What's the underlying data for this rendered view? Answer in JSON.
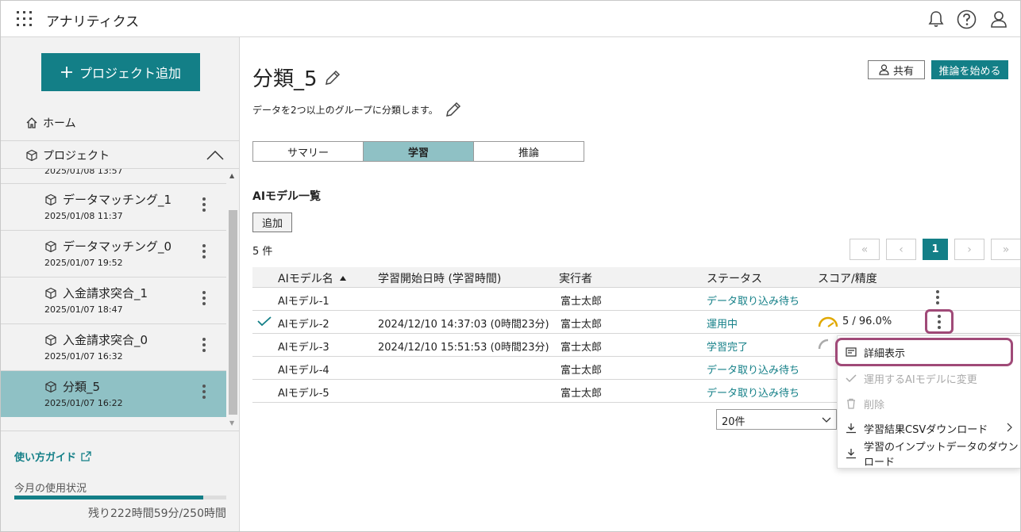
{
  "header": {
    "app_title": "アナリティクス",
    "icons": [
      "apps-icon",
      "bell-icon",
      "help-icon",
      "user-icon"
    ]
  },
  "sidebar": {
    "add_project_label": "プロジェクト追加",
    "home_label": "ホーム",
    "project_label": "プロジェクト",
    "clipped_date": "2025/01/08 13:57",
    "projects": [
      {
        "name": "データマッチング_1",
        "date": "2025/01/08 11:37"
      },
      {
        "name": "データマッチング_0",
        "date": "2025/01/07 19:52"
      },
      {
        "name": "入金請求突合_1",
        "date": "2025/01/07 18:47"
      },
      {
        "name": "入金請求突合_0",
        "date": "2025/01/07 16:32"
      },
      {
        "name": "分類_5",
        "date": "2025/01/07 16:22",
        "active": true
      }
    ],
    "guide_label": "使い方ガイド",
    "usage_title": "今月の使用状況",
    "usage_text": "残り222時間59分/250時間",
    "usage_fraction": 0.89
  },
  "main": {
    "title": "分類_5",
    "description": "データを2つ以上のグループに分類します。",
    "share_label": "共有",
    "infer_label": "推論を始める",
    "tabs": [
      "サマリー",
      "学習",
      "推論"
    ],
    "active_tab": 1,
    "section_title": "AIモデル一覧",
    "add_label": "追加",
    "count": "5 件",
    "pager": {
      "first": "«",
      "prev": "‹",
      "current": "1",
      "next": "›",
      "last": "»"
    },
    "table": {
      "columns": [
        "AIモデル名",
        "学習開始日時 (学習時間)",
        "実行者",
        "ステータス",
        "スコア/精度"
      ],
      "rows": [
        {
          "name": "AIモデル-1",
          "start": "",
          "user": "富士太郎",
          "status": "データ取り込み待ち",
          "score": "",
          "checked": false
        },
        {
          "name": "AIモデル-2",
          "start": "2024/12/10 14:37:03 (0時間23分)",
          "user": "富士太郎",
          "status": "運用中",
          "score": "5 / 96.0%",
          "checked": true
        },
        {
          "name": "AIモデル-3",
          "start": "2024/12/10 15:51:53 (0時間23分)",
          "user": "富士太郎",
          "status": "学習完了",
          "score": "",
          "checked": false
        },
        {
          "name": "AIモデル-4",
          "start": "",
          "user": "富士太郎",
          "status": "データ取り込み待ち",
          "score": "",
          "checked": false
        },
        {
          "name": "AIモデル-5",
          "start": "",
          "user": "富士太郎",
          "status": "データ取り込み待ち",
          "score": "",
          "checked": false
        }
      ]
    },
    "per_page": "20件"
  },
  "context_menu": {
    "items": [
      {
        "label": "詳細表示",
        "icon": "detail-icon",
        "disabled": false
      },
      {
        "label": "運用するAIモデルに変更",
        "icon": "check-icon",
        "disabled": true
      },
      {
        "label": "削除",
        "icon": "trash-icon",
        "disabled": true
      },
      {
        "label": "学習結果CSVダウンロード",
        "icon": "download-icon",
        "disabled": false,
        "submenu": true
      },
      {
        "label": "学習のインプットデータのダウンロード",
        "icon": "download-icon",
        "disabled": false
      }
    ]
  },
  "colors": {
    "accent": "#137f87",
    "active_bg": "#8fc1c5",
    "highlight": "#a04a78",
    "gauge": "#e0a800"
  }
}
